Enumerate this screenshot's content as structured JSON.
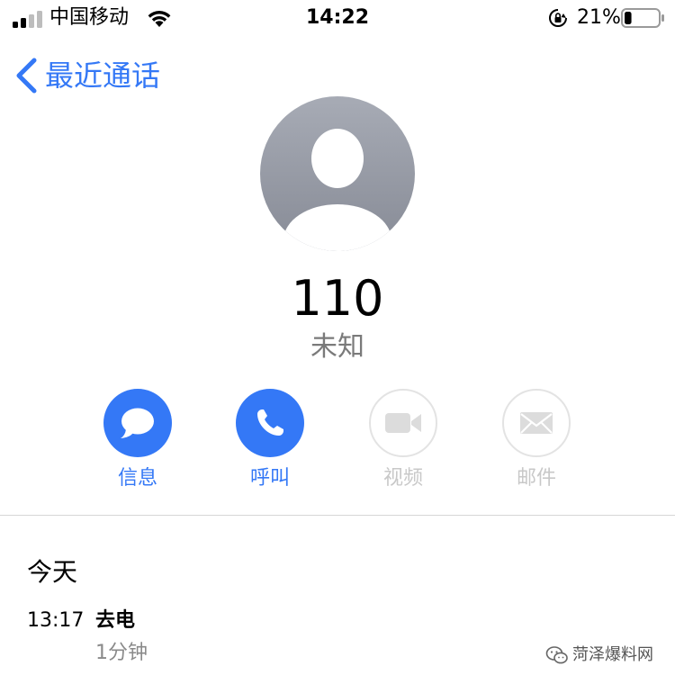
{
  "status_bar": {
    "carrier": "中国移动",
    "time": "14:22",
    "battery_percent": "21%",
    "battery_level": 0.21,
    "icons": [
      "signal-icon",
      "wifi-icon",
      "rotation-lock-icon",
      "battery-icon"
    ]
  },
  "nav": {
    "back_label": "最近通话",
    "back_icon": "chevron-left-icon"
  },
  "contact": {
    "avatar_icon": "person-silhouette-icon",
    "number": "110",
    "label": "未知"
  },
  "actions": [
    {
      "label": "信息",
      "icon": "message-bubble-icon",
      "enabled": true
    },
    {
      "label": "呼叫",
      "icon": "phone-icon",
      "enabled": true
    },
    {
      "label": "视频",
      "icon": "video-camera-icon",
      "enabled": false
    },
    {
      "label": "邮件",
      "icon": "mail-envelope-icon",
      "enabled": false
    }
  ],
  "history": {
    "section_title": "今天",
    "entries": [
      {
        "time": "13:17",
        "type": "去电",
        "duration": "1分钟"
      }
    ]
  },
  "watermark": {
    "text": "菏泽爆料网",
    "icon": "wechat-icon"
  },
  "colors": {
    "accent": "#3478f6",
    "disabled_border": "#e3e3e3",
    "disabled_text": "#c8c8c8",
    "secondary_text": "#7a7a7a"
  }
}
